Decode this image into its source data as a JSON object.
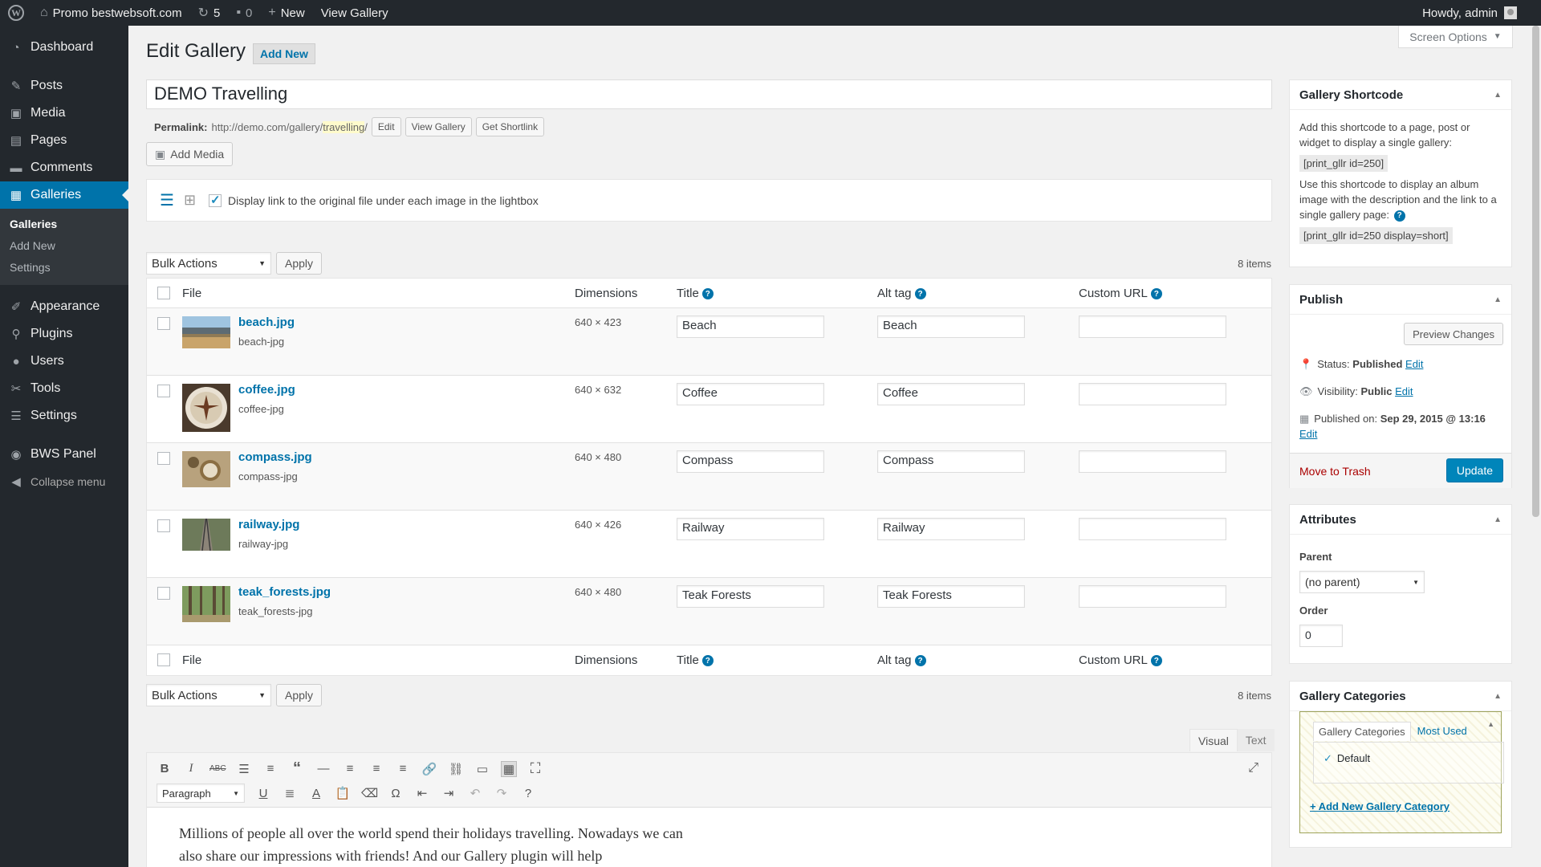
{
  "admin_bar": {
    "site_name": "Promo bestwebsoft.com",
    "updates_count": "5",
    "comments_count": "0",
    "new_label": "New",
    "view_gallery": "View Gallery",
    "howdy": "Howdy, admin"
  },
  "sidebar": {
    "items": [
      {
        "label": "Dashboard",
        "icon": "dashboard-icon"
      },
      {
        "label": "Posts",
        "icon": "pin-icon"
      },
      {
        "label": "Media",
        "icon": "media-icon"
      },
      {
        "label": "Pages",
        "icon": "pages-icon"
      },
      {
        "label": "Comments",
        "icon": "comment-icon"
      },
      {
        "label": "Galleries",
        "icon": "grid-icon"
      },
      {
        "label": "Appearance",
        "icon": "brush-icon"
      },
      {
        "label": "Plugins",
        "icon": "plug-icon"
      },
      {
        "label": "Users",
        "icon": "users-icon"
      },
      {
        "label": "Tools",
        "icon": "wrench-icon"
      },
      {
        "label": "Settings",
        "icon": "settings-icon"
      },
      {
        "label": "BWS Panel",
        "icon": "bws-icon"
      },
      {
        "label": "Collapse menu",
        "icon": "collapse-icon"
      }
    ],
    "submenu": [
      "Galleries",
      "Add New",
      "Settings"
    ]
  },
  "screen_options": "Screen Options",
  "page": {
    "title": "Edit Gallery",
    "add_new": "Add New",
    "post_title": "DEMO Travelling",
    "permalink_label": "Permalink:",
    "permalink_base": "http://demo.com/gallery/",
    "permalink_slug": "travelling",
    "permalink_end": "/",
    "edit_btn": "Edit",
    "view_gallery_btn": "View Gallery",
    "shortlink_btn": "Get Shortlink",
    "add_media": "Add Media",
    "lightbox_option": "Display link to the original file under each image in the lightbox"
  },
  "table": {
    "bulk_actions": "Bulk Actions",
    "apply": "Apply",
    "items_count": "8 items",
    "columns": {
      "file": "File",
      "dimensions": "Dimensions",
      "title": "Title",
      "alt": "Alt tag",
      "url": "Custom URL"
    },
    "rows": [
      {
        "file": "beach.jpg",
        "sub": "beach-jpg",
        "dim": "640 × 423",
        "title": "Beach",
        "alt": "Beach",
        "url": ""
      },
      {
        "file": "coffee.jpg",
        "sub": "coffee-jpg",
        "dim": "640 × 632",
        "title": "Coffee",
        "alt": "Coffee",
        "url": ""
      },
      {
        "file": "compass.jpg",
        "sub": "compass-jpg",
        "dim": "640 × 480",
        "title": "Compass",
        "alt": "Compass",
        "url": ""
      },
      {
        "file": "railway.jpg",
        "sub": "railway-jpg",
        "dim": "640 × 426",
        "title": "Railway",
        "alt": "Railway",
        "url": ""
      },
      {
        "file": "teak_forests.jpg",
        "sub": "teak_forests-jpg",
        "dim": "640 × 480",
        "title": "Teak Forests",
        "alt": "Teak Forests",
        "url": ""
      }
    ]
  },
  "editor": {
    "tab_visual": "Visual",
    "tab_text": "Text",
    "format": "Paragraph",
    "content": "Millions of people all over the world spend their holidays travelling. Nowadays we can also share our impressions with friends! And our Gallery plugin will help"
  },
  "shortcode_box": {
    "title": "Gallery Shortcode",
    "text1": "Add this shortcode to a page, post or widget to display a single gallery:",
    "code1": "[print_gllr id=250]",
    "text2": "Use this shortcode to display an album image with the description and the link to a single gallery page:",
    "code2": "[print_gllr id=250 display=short]"
  },
  "publish_box": {
    "title": "Publish",
    "preview": "Preview Changes",
    "status_label": "Status:",
    "status_value": "Published",
    "visibility_label": "Visibility:",
    "visibility_value": "Public",
    "published_label": "Published on:",
    "published_value": "Sep 29, 2015 @ 13:16",
    "edit": "Edit",
    "trash": "Move to Trash",
    "update": "Update"
  },
  "attributes_box": {
    "title": "Attributes",
    "parent_label": "Parent",
    "parent_value": "(no parent)",
    "order_label": "Order",
    "order_value": "0"
  },
  "categories_box": {
    "title": "Gallery Categories",
    "tab_all": "Gallery Categories",
    "tab_used": "Most Used",
    "item": "Default",
    "add_new": "+ Add New Gallery Category"
  },
  "colors": {
    "accent": "#0073aa",
    "adminbar": "#23282d",
    "update_button": "#0085ba",
    "trash": "#a00"
  }
}
